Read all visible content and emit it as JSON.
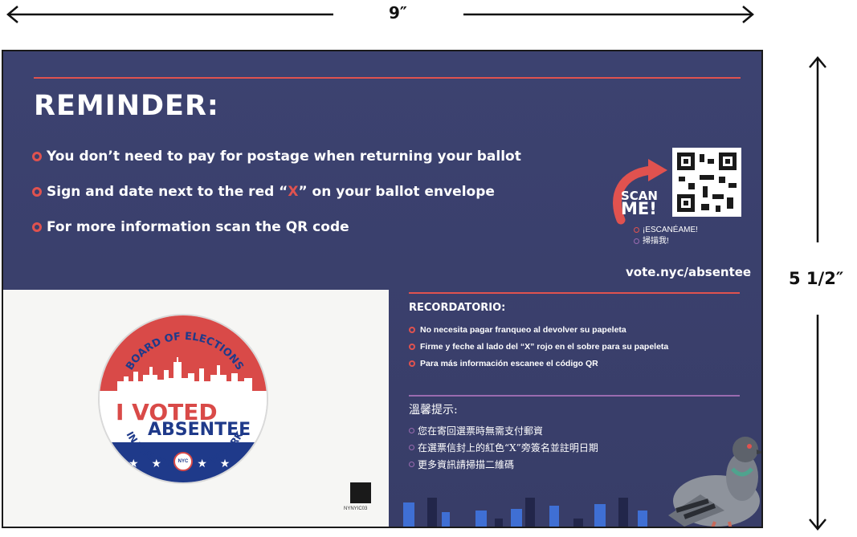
{
  "dimensions": {
    "width_label": "9″",
    "height_label": "5 1/2″"
  },
  "card": {
    "title": "REMINDER:",
    "bullets": [
      {
        "text_before": "You don’t need to pay for postage when returning your ballot",
        "highlight": "",
        "text_after": ""
      },
      {
        "text_before": "Sign and date next to the red “",
        "highlight": "X",
        "text_after": "” on your ballot envelope"
      },
      {
        "text_before": "For more information scan the QR code",
        "highlight": "",
        "text_after": ""
      }
    ],
    "scan": {
      "scan_label": "SCAN",
      "me_label": "ME!",
      "es_label": "¡ESCANÉAME!",
      "zh_label": "掃描我!"
    },
    "url": "vote.nyc/absentee",
    "spanish": {
      "title": "RECORDATORIO:",
      "items": [
        "No necesita pagar franqueo al devolver su papeleta",
        "Firme y feche al lado del “X” rojo en el sobre para su papeleta",
        "Para más información escanee el código QR"
      ]
    },
    "chinese": {
      "title": "溫馨提示:",
      "items": [
        "您在寄回選票時無需支付郵資",
        "在選票信封上的紅色“X”旁簽名並註明日期",
        "更多資訊請掃描二維碼"
      ]
    },
    "sticker": {
      "top_arc": "BOARD OF ELECTIONS",
      "line1": "I VOTED",
      "line2": "ABSENTEE",
      "bottom_arc": "IN THE CITY OF NEW YORK",
      "badge": "NYC"
    },
    "mini_qr_label": "NYNYIC03"
  },
  "colors": {
    "card_bg": "#3a3f6c",
    "accent_red": "#e0524f",
    "accent_purple": "#9a6bb0",
    "sticker_blue": "#1f3a8a",
    "bar_blue": "#3f6fd4"
  }
}
